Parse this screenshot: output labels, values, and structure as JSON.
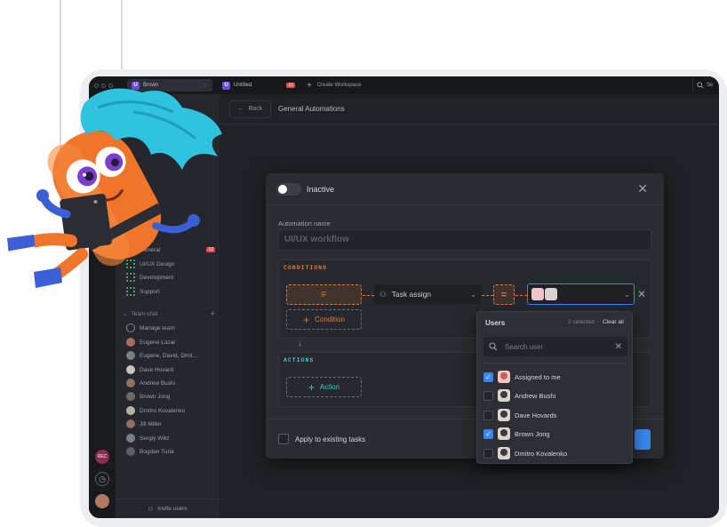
{
  "topbar": {
    "active_tab": "Brown",
    "second_tab": "Untitled",
    "second_tab_badge": "12",
    "create_workspace": "Create Workspace",
    "search_label": "Se"
  },
  "rail": {
    "badge_label": "REC"
  },
  "sidebar": {
    "channels": [
      {
        "label": "General",
        "count": "12"
      },
      {
        "label": "UI/UX Design"
      },
      {
        "label": "Development"
      },
      {
        "label": "Support"
      }
    ],
    "team_chat_label": "Team chat",
    "people": [
      "Manage team",
      "Eugene Lazar",
      "Eugene, David, Dmit...",
      "Dave Hovard",
      "Andrew Bushi",
      "Brown Jong",
      "Dmitro Kovalenko",
      "Jill Miller",
      "Sergiy Wild",
      "Bogdan Turia"
    ],
    "invite_label": "Invite users"
  },
  "header": {
    "back_label": "Back",
    "breadcrumb": "General Automations"
  },
  "modal": {
    "status_label": "Inactive",
    "toggle_on": false,
    "name_label": "Automation name",
    "name_value": "UI/UX workflow",
    "conditions_title": "CONDITIONS",
    "if_label": "IF",
    "condition_button": "Condition",
    "task_select_value": "Task assign",
    "operator": "=",
    "actions_title": "ACTIONS",
    "action_button": "Action",
    "apply_label": "Apply to existing tasks"
  },
  "dropdown": {
    "title": "Users",
    "selected_count": "2 selected",
    "clear_label": "Clear all",
    "search_placeholder": "Search user",
    "options": [
      {
        "label": "Assigned to me",
        "checked": true
      },
      {
        "label": "Andrew Bushi",
        "checked": false
      },
      {
        "label": "Dave Hovards",
        "checked": false
      },
      {
        "label": "Brown Jong",
        "checked": true
      },
      {
        "label": "Dmitro Kovalenko",
        "checked": false
      }
    ]
  },
  "colors": {
    "accent_blue": "#3a86f0",
    "accent_orange": "#e07a34",
    "accent_teal": "#4bc2c8",
    "badge_red": "#e04b4b",
    "mascot_orange": "#f0742a",
    "mascot_hair": "#2fc3e0"
  }
}
